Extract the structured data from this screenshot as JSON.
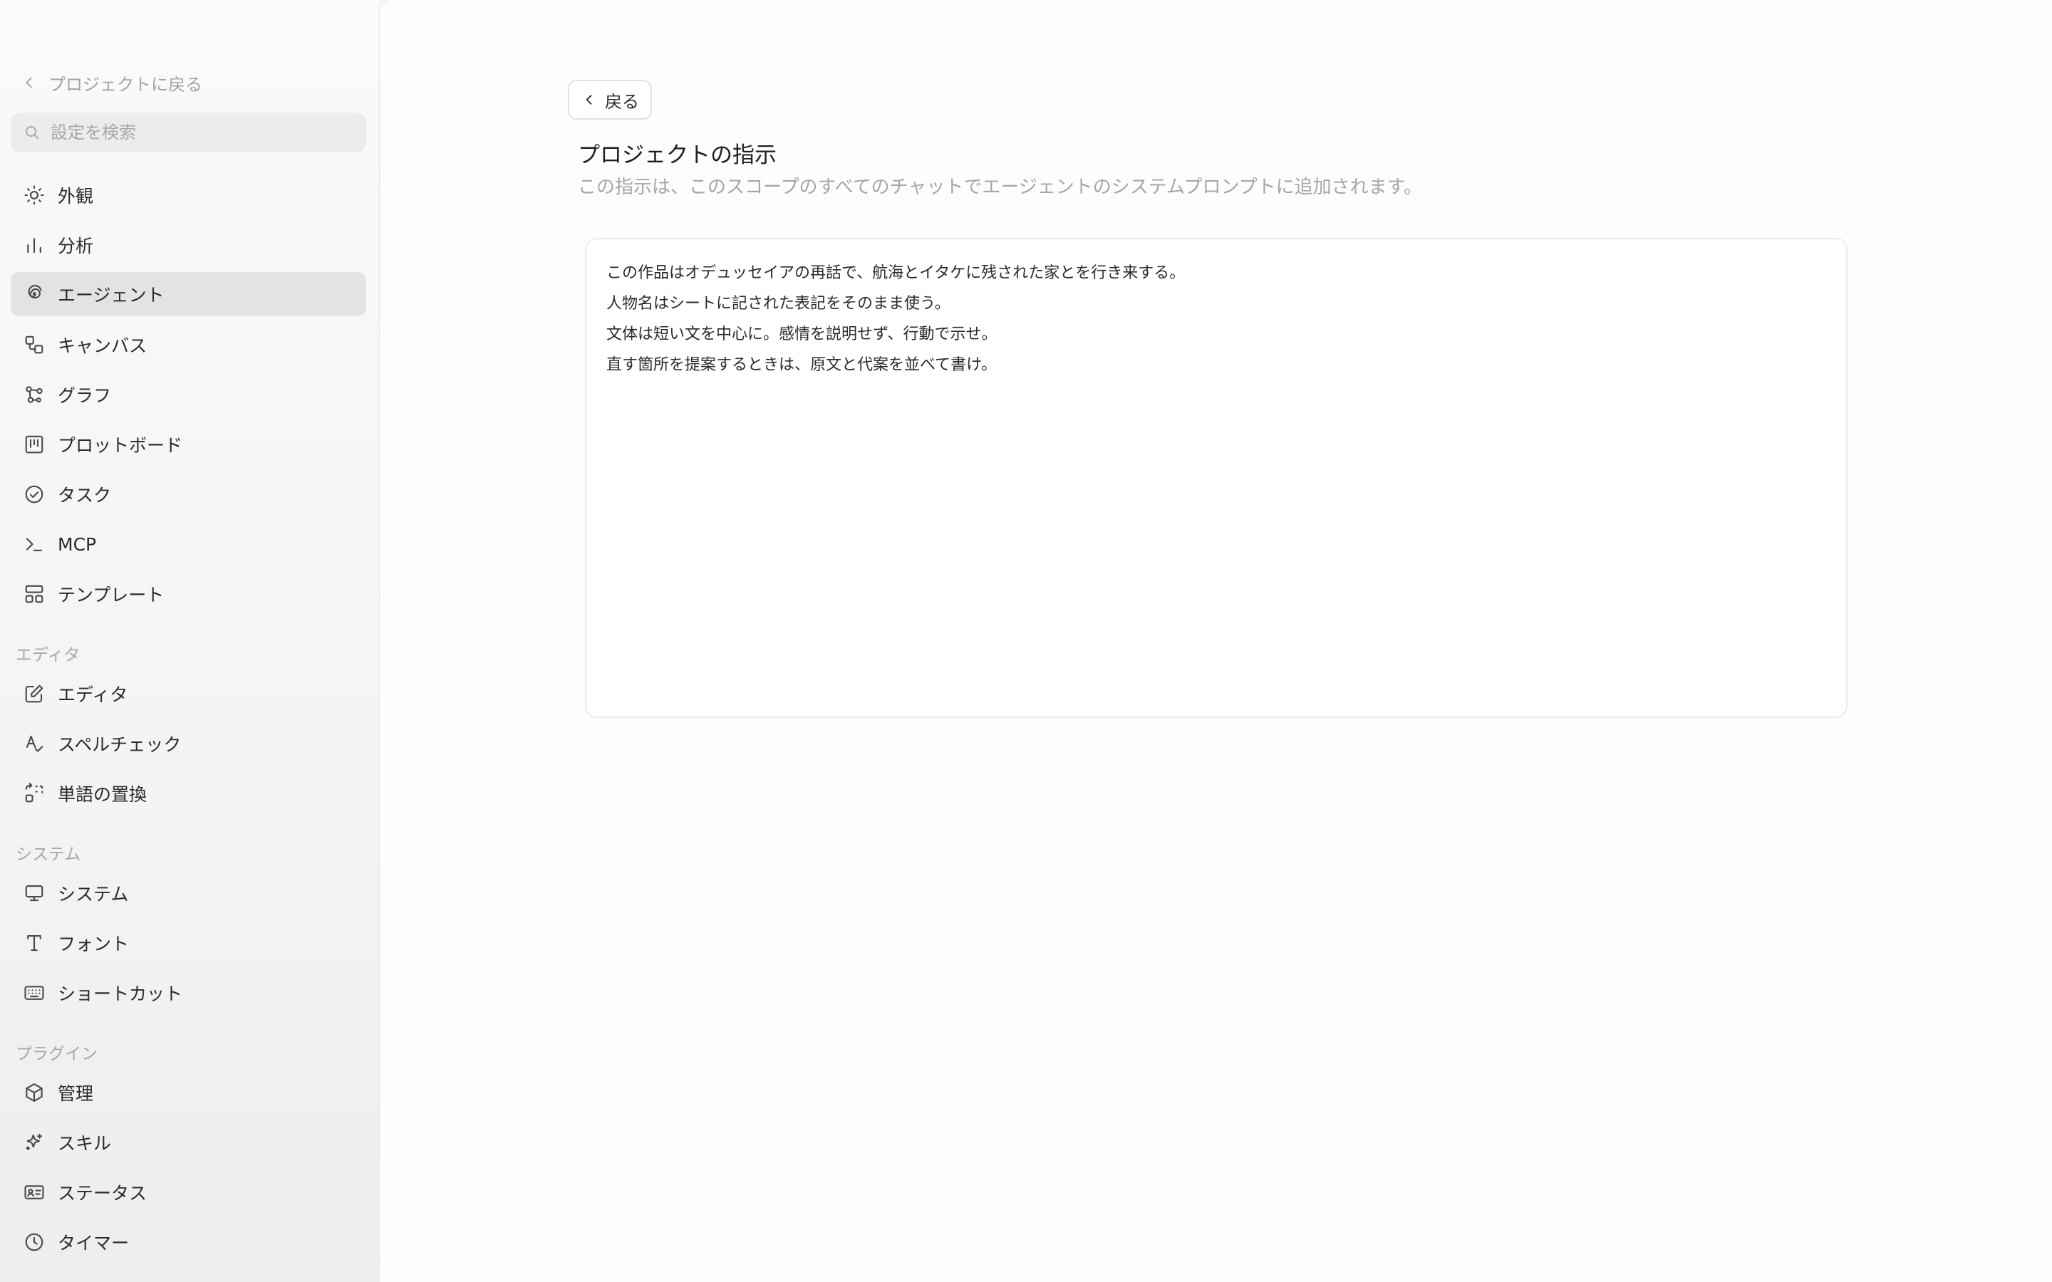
{
  "sidebar": {
    "back_label": "プロジェクトに戻る",
    "search_placeholder": "設定を検索",
    "items": [
      {
        "label": "外観",
        "icon": "sun-icon"
      },
      {
        "label": "分析",
        "icon": "bar-chart-icon"
      },
      {
        "label": "エージェント",
        "icon": "spiral-icon",
        "active": true
      },
      {
        "label": "キャンバス",
        "icon": "canvas-icon"
      },
      {
        "label": "グラフ",
        "icon": "graph-icon"
      },
      {
        "label": "プロットボード",
        "icon": "kanban-icon"
      },
      {
        "label": "タスク",
        "icon": "check-circle-icon"
      },
      {
        "label": "MCP",
        "icon": "terminal-icon"
      },
      {
        "label": "テンプレート",
        "icon": "template-icon"
      }
    ],
    "sections": [
      {
        "label": "エディタ",
        "items": [
          {
            "label": "エディタ",
            "icon": "edit-icon"
          },
          {
            "label": "スペルチェック",
            "icon": "spellcheck-icon"
          },
          {
            "label": "単語の置換",
            "icon": "replace-icon"
          }
        ]
      },
      {
        "label": "システム",
        "items": [
          {
            "label": "システム",
            "icon": "monitor-icon"
          },
          {
            "label": "フォント",
            "icon": "type-icon"
          },
          {
            "label": "ショートカット",
            "icon": "keyboard-icon"
          }
        ]
      },
      {
        "label": "プラグイン",
        "items": [
          {
            "label": "管理",
            "icon": "package-icon"
          },
          {
            "label": "スキル",
            "icon": "sparkles-icon"
          },
          {
            "label": "ステータス",
            "icon": "id-card-icon"
          },
          {
            "label": "タイマー",
            "icon": "clock-icon"
          }
        ]
      }
    ]
  },
  "main": {
    "back_button_label": "戻る",
    "title": "プロジェクトの指示",
    "description": "この指示は、このスコープのすべてのチャットでエージェントのシステムプロンプトに追加されます。",
    "instructions_text": "この作品はオデュッセイアの再話で、航海とイタケに残された家とを行き来する。\n人物名はシートに記された表記をそのまま使う。\n文体は短い文を中心に。感情を説明せず、行動で示せ。\n直す箇所を提案するときは、原文と代案を並べて書け。"
  },
  "colors": {
    "sidebar_bg": "#f4f4f4",
    "active_item_bg": "#e3e3e3",
    "main_bg": "#fdfdfd",
    "muted_text": "#a6a6a6"
  }
}
